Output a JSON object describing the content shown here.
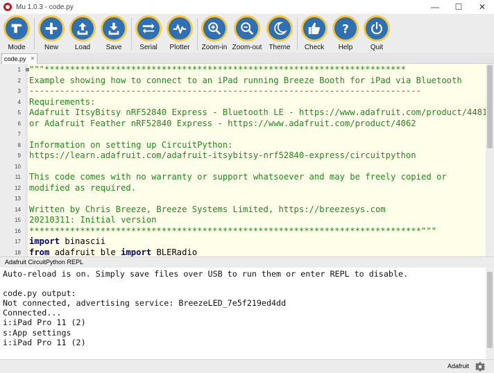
{
  "window": {
    "title": "Mu 1.0.3 - code.py",
    "controls": {
      "minimize": "—",
      "maximize": "☐",
      "close": "✕"
    }
  },
  "toolbar": {
    "buttons": [
      {
        "label": "Mode",
        "icon": "mode-icon"
      },
      {
        "label": "New",
        "icon": "plus-icon"
      },
      {
        "label": "Load",
        "icon": "upload-icon"
      },
      {
        "label": "Save",
        "icon": "download-icon"
      },
      {
        "label": "Serial",
        "icon": "arrows-icon"
      },
      {
        "label": "Plotter",
        "icon": "pulse-icon"
      },
      {
        "label": "Zoom-in",
        "icon": "zoom-in-icon"
      },
      {
        "label": "Zoom-out",
        "icon": "zoom-out-icon"
      },
      {
        "label": "Theme",
        "icon": "moon-icon"
      },
      {
        "label": "Check",
        "icon": "thumbs-up-icon"
      },
      {
        "label": "Help",
        "icon": "question-icon"
      },
      {
        "label": "Quit",
        "icon": "power-icon"
      }
    ],
    "colors": {
      "button_fill": "#2f6fb4",
      "button_ring": "#f6c93b"
    }
  },
  "tabs": [
    {
      "label": "code.py",
      "close": "✕"
    }
  ],
  "editor": {
    "lines": [
      {
        "n": "1",
        "parts": [
          {
            "t": "\"\"\"***********************************************************************",
            "c": "doc"
          }
        ]
      },
      {
        "n": "2",
        "parts": [
          {
            "t": "Example showing how to connect to an iPad running Breeze Booth for iPad via Bluetooth",
            "c": "doc"
          }
        ]
      },
      {
        "n": "3",
        "parts": [
          {
            "t": "-----------------------------------------------------------------------------",
            "c": "doc"
          }
        ]
      },
      {
        "n": "4",
        "parts": [
          {
            "t": "Requirements:",
            "c": "doc"
          }
        ]
      },
      {
        "n": "5",
        "parts": [
          {
            "t": "Adafruit ItsyBitsy nRF52840 Express - Bluetooth LE - https://www.adafruit.com/product/4481",
            "c": "doc"
          }
        ]
      },
      {
        "n": "6",
        "parts": [
          {
            "t": "or Adafruit Feather nRF52840 Express - https://www.adafruit.com/product/4062",
            "c": "doc"
          }
        ]
      },
      {
        "n": "7",
        "parts": [
          {
            "t": "",
            "c": "doc"
          }
        ]
      },
      {
        "n": "8",
        "parts": [
          {
            "t": "Information on setting up CircuitPython:",
            "c": "doc"
          }
        ]
      },
      {
        "n": "9",
        "parts": [
          {
            "t": "https://learn.adafruit.com/adafruit-itsybitsy-nrf52840-express/circuitpython",
            "c": "doc"
          }
        ]
      },
      {
        "n": "10",
        "parts": [
          {
            "t": "",
            "c": "doc"
          }
        ]
      },
      {
        "n": "11",
        "parts": [
          {
            "t": "This code comes with no warranty or support whatsoever and may be freely copied or",
            "c": "doc"
          }
        ]
      },
      {
        "n": "12",
        "parts": [
          {
            "t": "modified as required.",
            "c": "doc"
          }
        ]
      },
      {
        "n": "13",
        "parts": [
          {
            "t": "",
            "c": "doc"
          }
        ]
      },
      {
        "n": "14",
        "parts": [
          {
            "t": "Written by Chris Breeze, Breeze Systems Limited, https://breezesys.com",
            "c": "doc"
          }
        ]
      },
      {
        "n": "15",
        "parts": [
          {
            "t": "20210311: Initial version",
            "c": "doc"
          }
        ]
      },
      {
        "n": "16",
        "parts": [
          {
            "t": "*****************************************************************************\"\"\"",
            "c": "doc"
          }
        ]
      },
      {
        "n": "17",
        "parts": [
          {
            "t": "import",
            "c": "kw"
          },
          {
            "t": " binascii",
            "c": "plain"
          }
        ]
      },
      {
        "n": "18",
        "parts": [
          {
            "t": "from",
            "c": "kw"
          },
          {
            "t": " adafruit_ble ",
            "c": "plain"
          },
          {
            "t": "import",
            "c": "kw"
          },
          {
            "t": " BLERadio",
            "c": "plain"
          }
        ]
      }
    ],
    "colors": {
      "background": "#fefee9",
      "docstring": "#1f8b1f",
      "keyword": "#000080"
    }
  },
  "repl": {
    "title": "Adafruit CircuitPython REPL",
    "lines": [
      "Auto-reload is on. Simply save files over USB to run them or enter REPL to disable.",
      "",
      "code.py output:",
      "Not connected, advertising service: BreezeLED_7e5f219ed4dd",
      "Connected...",
      "i:iPad Pro 11 (2)",
      "s:App settings",
      "i:iPad Pro 11 (2)"
    ]
  },
  "statusbar": {
    "mode": "Adafruit"
  }
}
